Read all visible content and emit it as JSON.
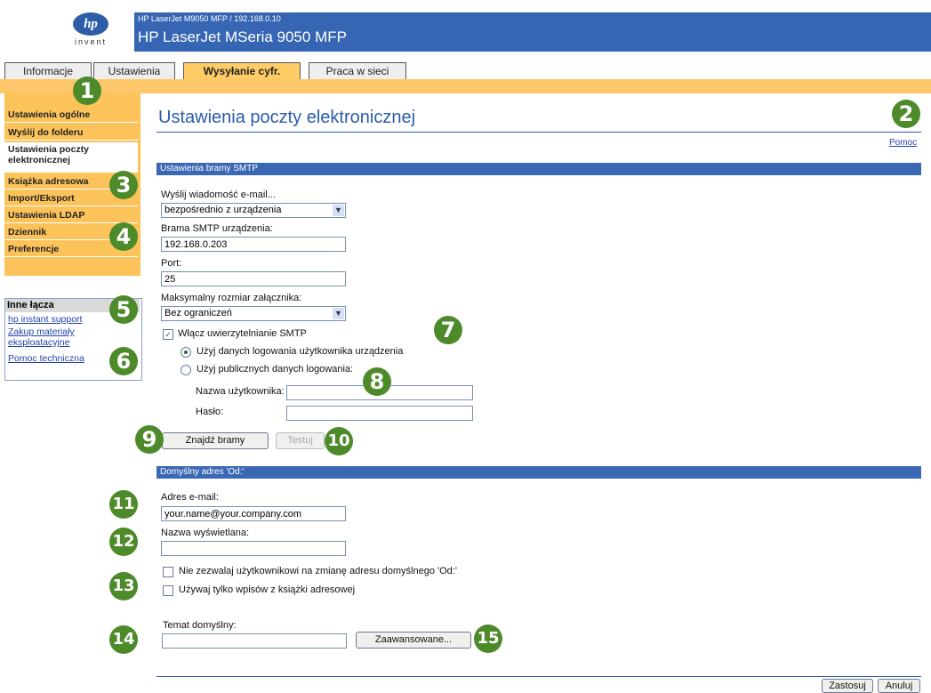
{
  "header": {
    "subtitle": "HP LaserJet M9050 MFP / 192.168.0.10",
    "title": "HP LaserJet MSeria 9050 MFP",
    "logo_text": "hp",
    "logo_tag": "invent"
  },
  "tabs": [
    "Informacje",
    "Ustawienia",
    "Wysyłanie cyfr.",
    "Praca w sieci"
  ],
  "sidebar": {
    "items": [
      "Ustawienia ogólne",
      "Wyślij do folderu",
      "Ustawienia poczty elektronicznej",
      "Książka adresowa",
      "Import/Eksport",
      "Ustawienia LDAP",
      "Dziennik",
      "Preferencje"
    ]
  },
  "other_links": {
    "heading": "Inne łącza",
    "links": [
      "hp instant support",
      "Zakup materiały eksploatacyjne",
      "Pomoc techniczna"
    ]
  },
  "main": {
    "title": "Ustawienia poczty elektronicznej",
    "help": "Pomoc",
    "smtp_section": "Ustawienia bramy SMTP",
    "send_label": "Wyślij wiadomość e-mail...",
    "send_value": "bezpośrednio z urządzenia",
    "gateway_label": "Brama SMTP urządzenia:",
    "gateway_value": "192.168.0.203",
    "port_label": "Port:",
    "port_value": "25",
    "max_attach_label": "Maksymalny rozmiar załącznika:",
    "max_attach_value": "Bez ograniczeń",
    "enable_auth": "Włącz uwierzytelnianie SMTP",
    "use_device_creds": "Użyj danych logowania użytkownika urządzenia",
    "use_public_creds": "Użyj publicznych danych logowania:",
    "username_label": "Nazwa użytkownika:",
    "password_label": "Hasło:",
    "find_gateways": "Znajdź bramy",
    "test": "Testuj",
    "from_section": "Domyślny adres 'Od:'",
    "email_label": "Adres e-mail:",
    "email_value": "your.name@your.company.com",
    "display_name_label": "Nazwa wyświetlana:",
    "no_change_from": "Nie zezwalaj użytkownikowi na zmianę adresu domyślnego 'Od:'",
    "only_address_book": "Używaj tylko wpisów z książki adresowej",
    "subject_label": "Temat domyślny:",
    "advanced": "Zaawansowane...",
    "apply": "Zastosuj",
    "cancel": "Anuluj"
  },
  "callouts": [
    "1",
    "2",
    "3",
    "4",
    "5",
    "6",
    "7",
    "8",
    "9",
    "10",
    "11",
    "12",
    "13",
    "14",
    "15"
  ],
  "colors": {
    "header": "#3665b3",
    "nav": "#fbc35a",
    "callout": "#4d8a2a",
    "link": "#2244aa"
  }
}
